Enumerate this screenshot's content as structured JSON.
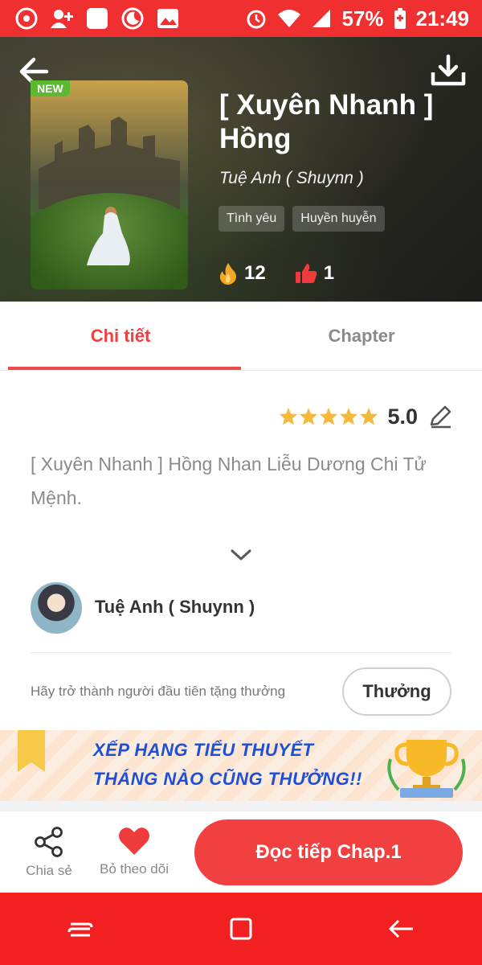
{
  "status_bar": {
    "battery": "57%",
    "time": "21:49"
  },
  "book": {
    "badge": "NEW",
    "title": "[ Xuyên Nhanh ] Hồng",
    "author": "Tuệ Anh ( Shuynn )",
    "tags": [
      "Tình yêu",
      "Huyền huyễn"
    ],
    "views": "12",
    "likes": "1"
  },
  "tabs": [
    {
      "label": "Chi tiết",
      "active": true
    },
    {
      "label": "Chapter",
      "active": false
    }
  ],
  "rating": {
    "stars": 5,
    "value": "5.0"
  },
  "description": "[ Xuyên Nhanh ] Hồng Nhan Liễu Dương Chi Tử Mệnh.",
  "author_section": {
    "name": "Tuệ Anh ( Shuynn )"
  },
  "reward": {
    "text": "Hãy trở thành người đầu tiên tặng thưởng",
    "button_label": "Thưởng"
  },
  "banner": {
    "line1": "XẾP HẠNG TIỂU THUYẾT",
    "line2": "THÁNG NÀO CŨNG THƯỞNG!!"
  },
  "actions": {
    "share_label": "Chia sẻ",
    "unfollow_label": "Bỏ theo dõi",
    "read_label": "Đọc tiếp Chap.1"
  },
  "colors": {
    "accent": "#f23f3f",
    "status_bar": "#f03030",
    "star": "#f6b93b",
    "banner_text": "#1e4fd8"
  },
  "icons": [
    "back-arrow-icon",
    "download-icon",
    "flame-icon",
    "thumbs-up-icon",
    "star-icon",
    "edit-pencil-icon",
    "chevron-down-icon",
    "share-icon",
    "heart-icon",
    "trophy-icon"
  ]
}
